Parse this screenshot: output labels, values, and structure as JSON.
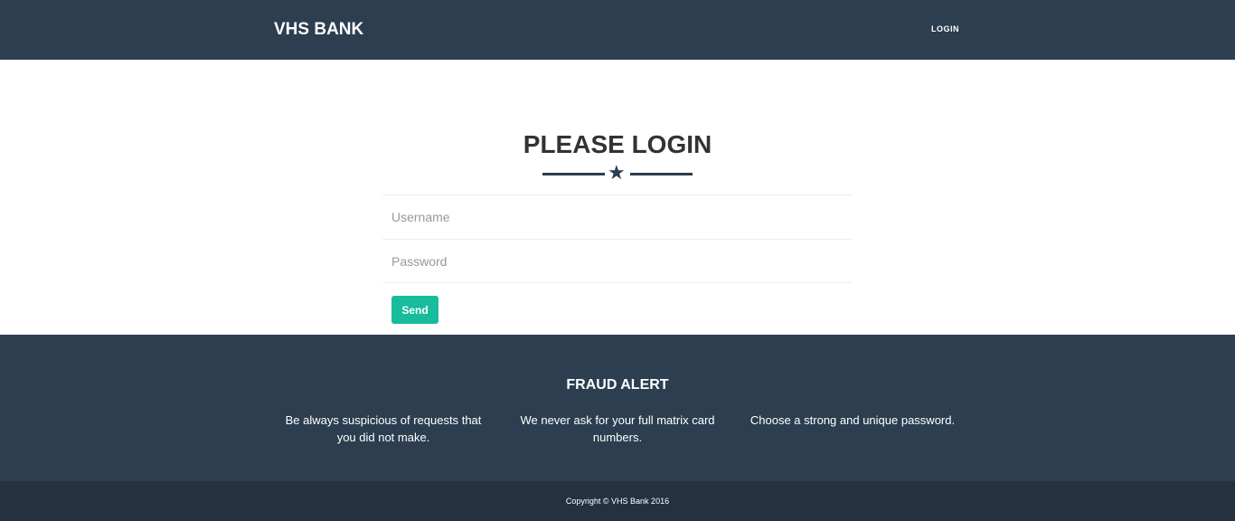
{
  "nav": {
    "brand": "VHS BANK",
    "login": "LOGIN"
  },
  "main": {
    "title": "PLEASE LOGIN",
    "username_placeholder": "Username",
    "password_placeholder": "Password",
    "send": "Send"
  },
  "footer": {
    "title": "FRAUD ALERT",
    "columns": [
      "Be always suspicious of requests that you did not make.",
      "We never ask for your full matrix card numbers.",
      "Choose a strong and unique password."
    ],
    "copyright": "Copyright © VHS Bank 2016"
  }
}
